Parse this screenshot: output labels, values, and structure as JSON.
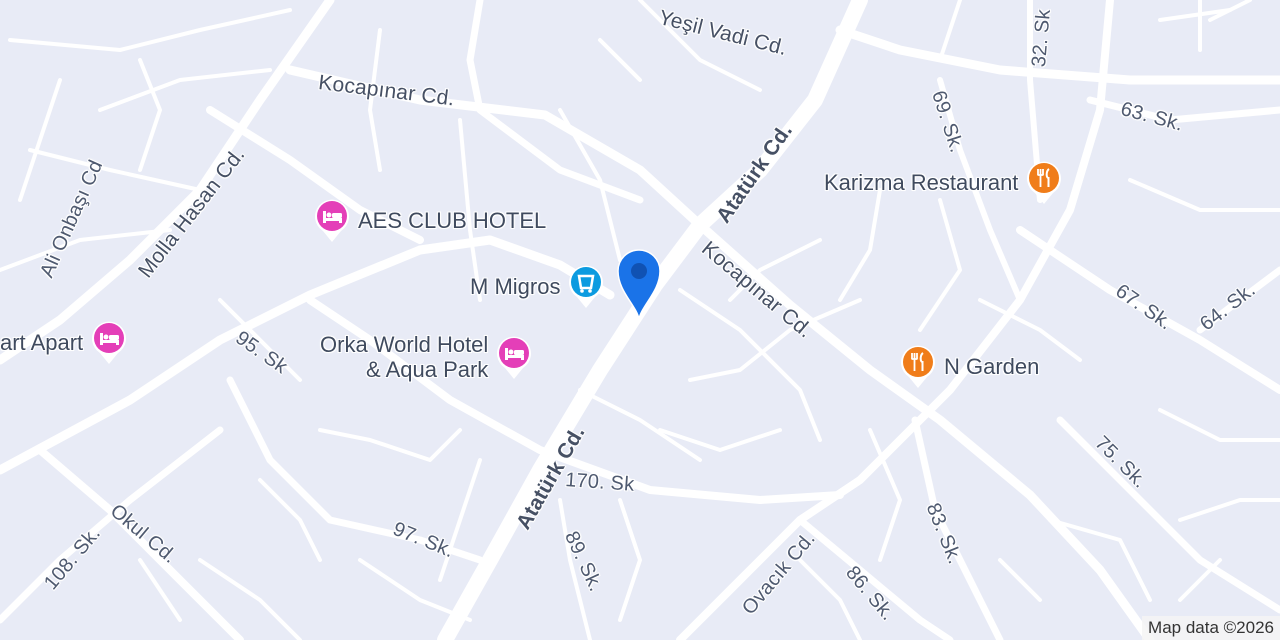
{
  "colors": {
    "background": "#e8ebf6",
    "road": "#ffffff",
    "hotel": "#e43fb8",
    "restaurant": "#f07d1a",
    "shopping": "#0c9be0",
    "marker": "#1a73e8"
  },
  "streets": {
    "kocapinar_top": "Kocapınar Cd.",
    "kocapinar_mid": "Kocapınar Cd.",
    "yesil_vadi": "Yeşil Vadi Cd.",
    "ataturk_top": "Atatürk Cd.",
    "ataturk_bottom": "Atatürk Cd.",
    "molla_hasan": "Molla Hasan Cd.",
    "ali_onbasi": "Ali Onbaşı Cd",
    "sk95": "95. Sk",
    "sk170": "170. Sk",
    "sk97": "97. Sk.",
    "sk89": "89. Sk.",
    "okul": "Okul Cd.",
    "sk108": "108. Sk.",
    "ovacik": "Ovacık Cd.",
    "sk86": "86. Sk.",
    "sk83": "83. Sk.",
    "sk75": "75. Sk.",
    "sk67": "67. Sk.",
    "sk64": "64. Sk.",
    "sk63": "63. Sk.",
    "sk69": "69. Sk.",
    "sk32": "32. Sk"
  },
  "pois": {
    "aes": {
      "name": "AES CLUB HOTEL",
      "icon": "hotel-icon"
    },
    "migros": {
      "name": "M Migros",
      "icon": "shopping-icon"
    },
    "orka_line1": "Orka World Hotel",
    "orka_line2": "& Aqua Park",
    "apart": {
      "name": "art Apart",
      "icon": "hotel-icon"
    },
    "karizma": {
      "name": "Karizma Restaurant",
      "icon": "restaurant-icon"
    },
    "ngarden": {
      "name": "N Garden",
      "icon": "restaurant-icon"
    }
  },
  "attribution": "Map data ©2026"
}
